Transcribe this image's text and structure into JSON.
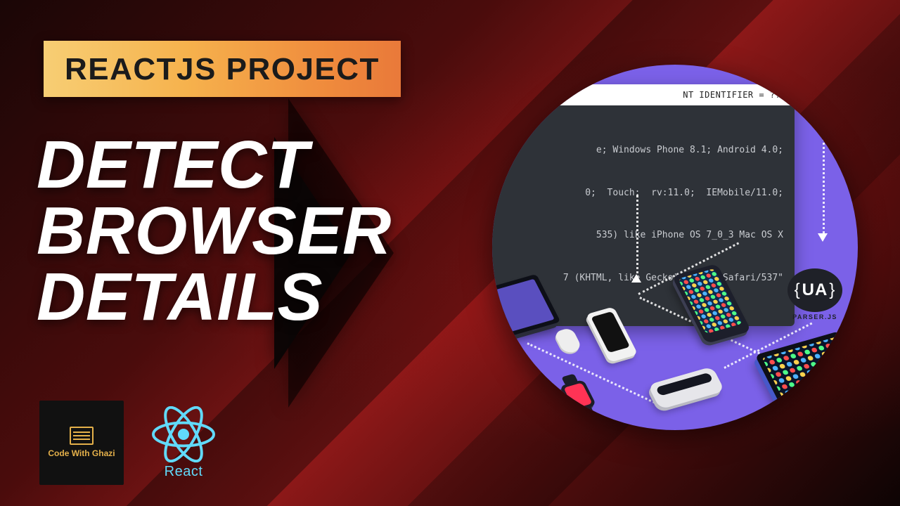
{
  "badge": {
    "label": "REACTJS PROJECT"
  },
  "headline": {
    "line1": "DETECT",
    "line2": "BROWSER",
    "line3": "DETAILS"
  },
  "logos": {
    "channel": {
      "name": "Code With Ghazi"
    },
    "react": {
      "label": "React"
    }
  },
  "illustration": {
    "terminal": {
      "header": "NT IDENTIFIER = ???",
      "lines": [
        "e; Windows Phone 8.1; Android 4.0;",
        "0;  Touch;  rv:11.0;  IEMobile/11.0;",
        "535) like iPhone OS 7_0_3 Mac OS X",
        "7 (KHTML, like Gecko) Mobile Safari/537\""
      ]
    },
    "ua_badge": {
      "text": "UA",
      "sub": "PARSER.JS"
    }
  }
}
